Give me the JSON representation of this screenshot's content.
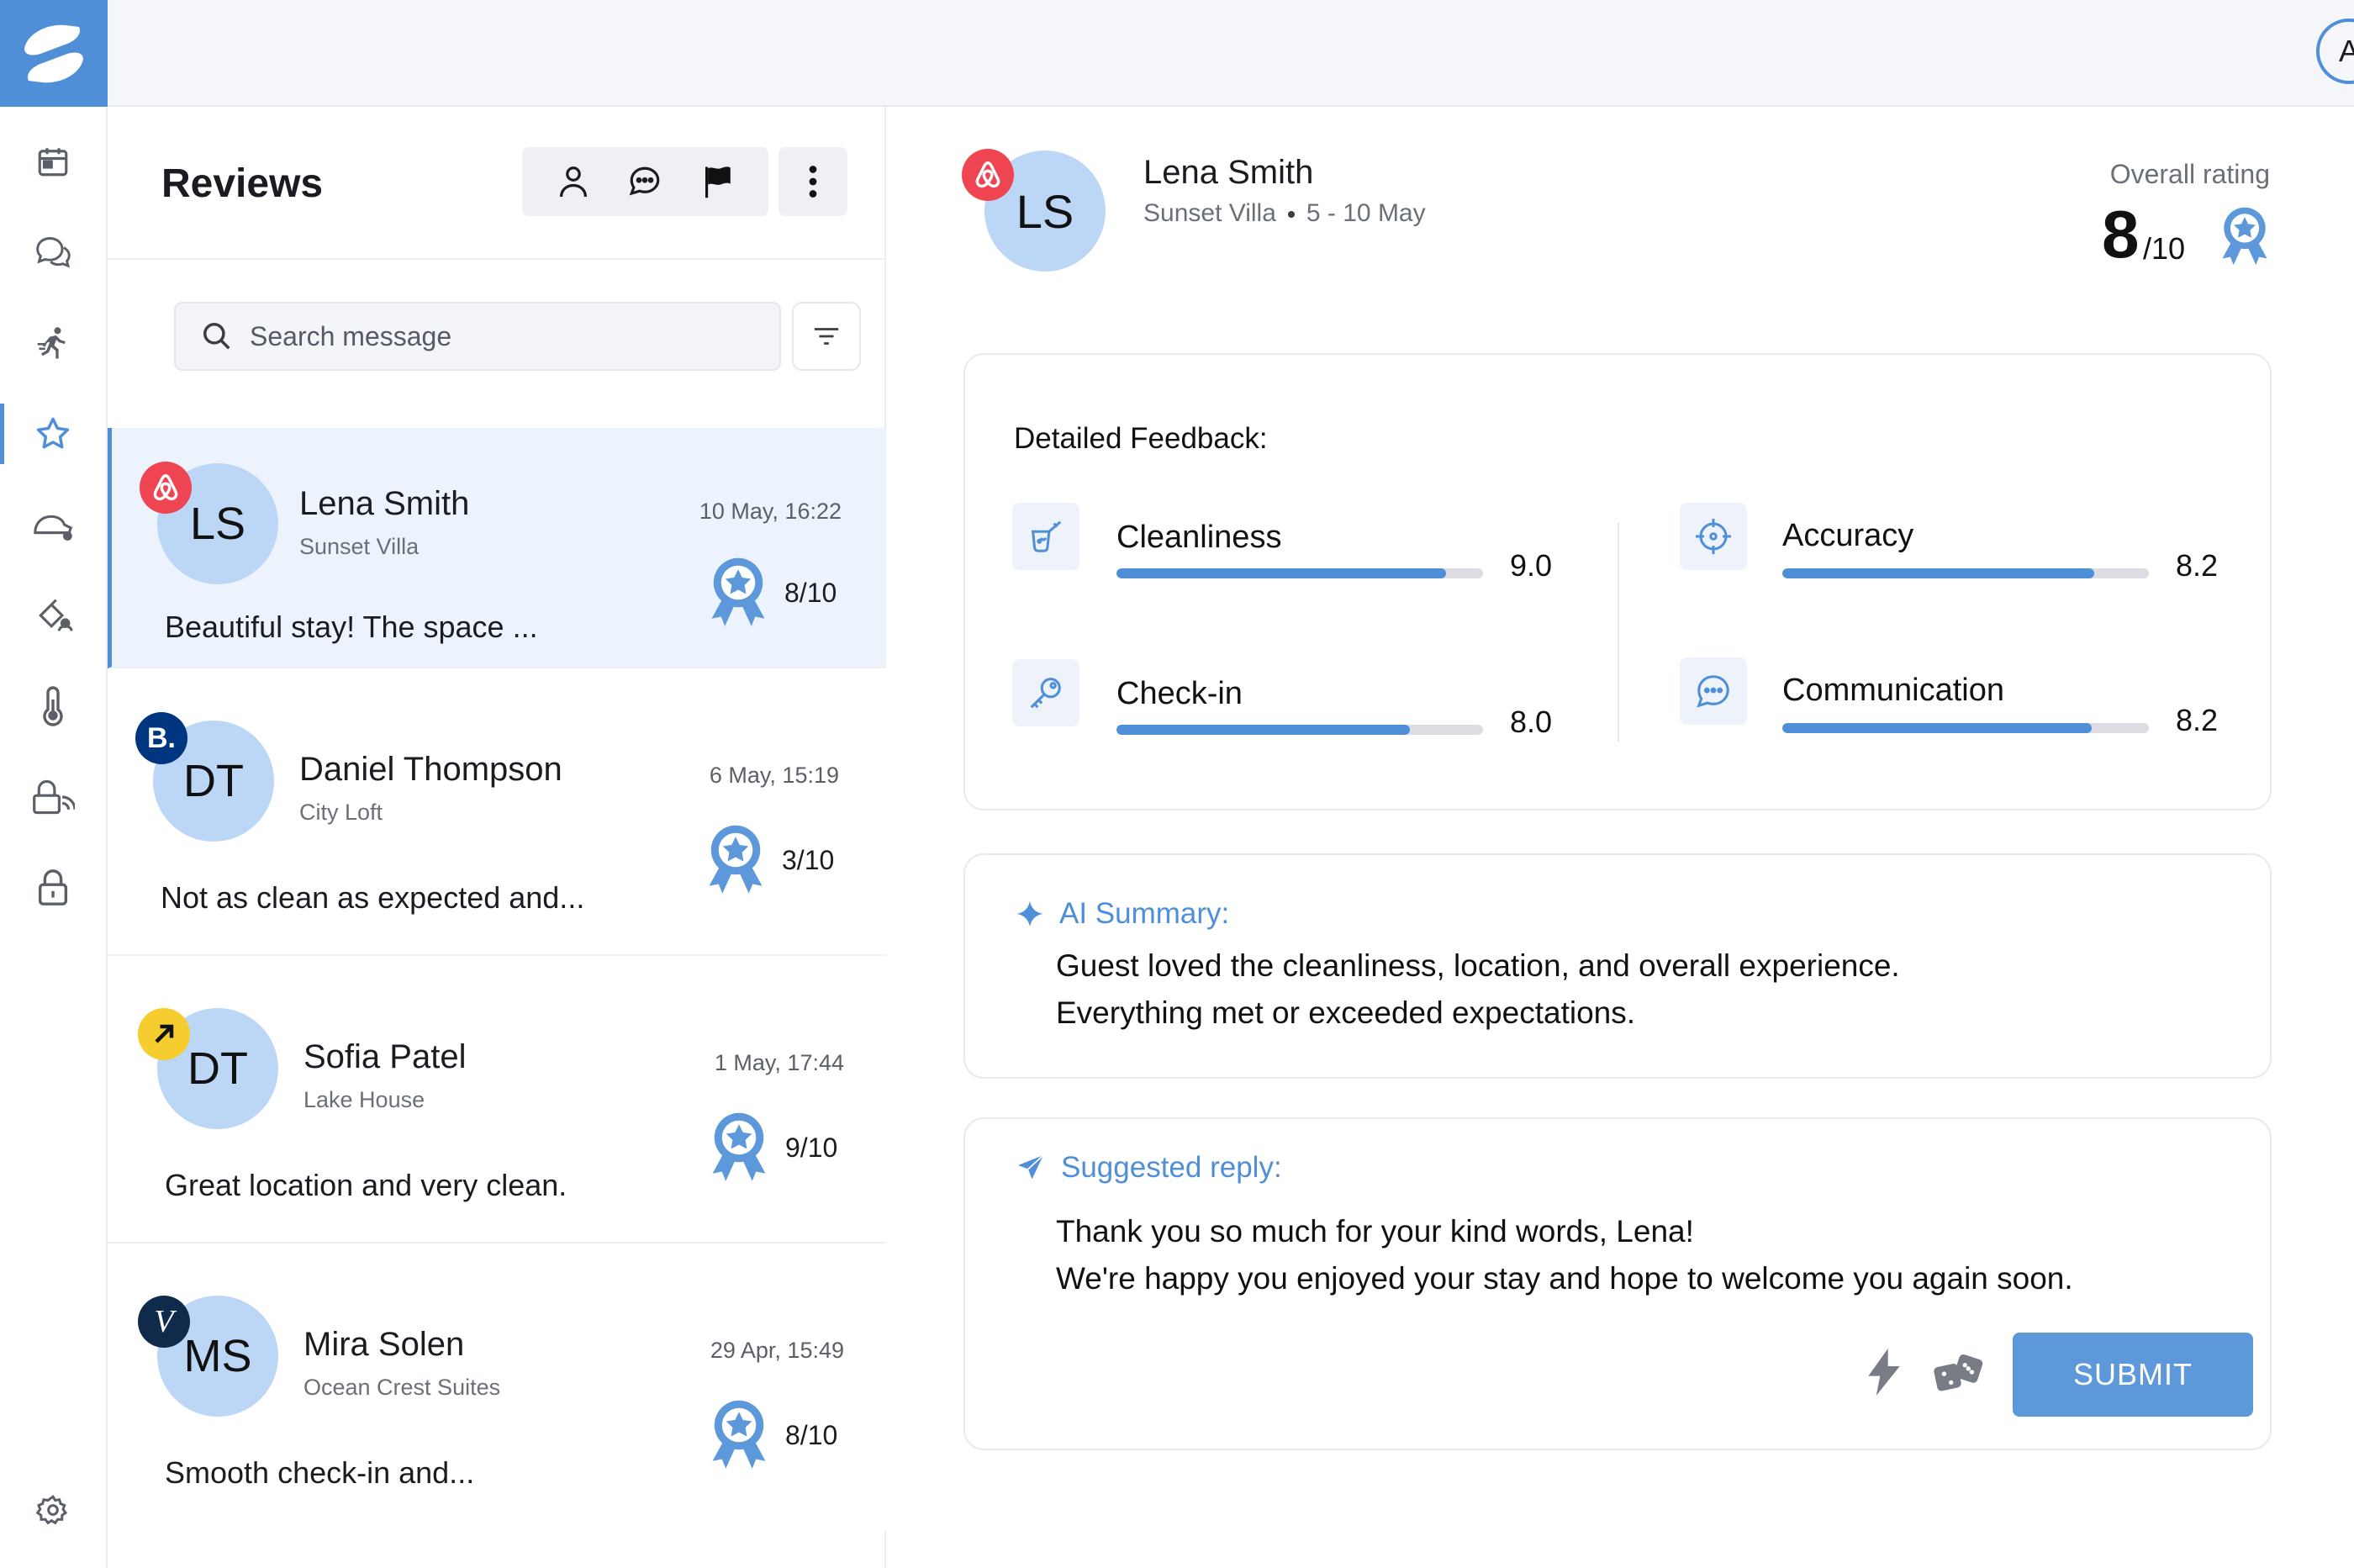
{
  "header": {
    "user_initial": "A"
  },
  "colors": {
    "accent": "#4f8fd8",
    "selected_bg": "#edf3fc",
    "avatar_bg": "#bcd7f5",
    "airbnb": "#ef4452",
    "booking": "#003580",
    "expedia": "#f5cd2e",
    "vrbo": "#102a4c"
  },
  "sidebar": {
    "items": [
      {
        "icon": "calendar-icon"
      },
      {
        "icon": "chat-bubbles-icon"
      },
      {
        "icon": "runner-icon"
      },
      {
        "icon": "star-icon",
        "active": true
      },
      {
        "icon": "cleaning-icon"
      },
      {
        "icon": "tools-icon"
      },
      {
        "icon": "thermometer-icon"
      },
      {
        "icon": "smart-lock-icon"
      },
      {
        "icon": "lock-icon"
      },
      {
        "icon": "settings-icon"
      }
    ]
  },
  "list": {
    "title": "Reviews",
    "search_placeholder": "Search message",
    "items": [
      {
        "initials": "LS",
        "name": "Lena Smith",
        "property": "Sunset Villa",
        "date": "10 May, 16:22",
        "score": "8/10",
        "text": "Beautiful stay! The space ...",
        "channel": "airbnb"
      },
      {
        "initials": "DT",
        "name": "Daniel Thompson",
        "property": "City Loft",
        "date": "6 May, 15:19",
        "score": "3/10",
        "text": "Not as clean as expected and...",
        "channel": "booking",
        "channel_label": "B."
      },
      {
        "initials": "DT",
        "name": "Sofia Patel",
        "property": "Lake House",
        "date": "1 May, 17:44",
        "score": "9/10",
        "text": "Great location and very clean.",
        "channel": "expedia"
      },
      {
        "initials": "MS",
        "name": "Mira Solen",
        "property": "Ocean Crest Suites",
        "date": "29 Apr, 15:49",
        "score": "8/10",
        "text": "Smooth check-in and...",
        "channel": "vrbo",
        "channel_label": "V"
      }
    ]
  },
  "detail": {
    "initials": "LS",
    "name": "Lena Smith",
    "property": "Sunset Villa",
    "dates": "5 - 10 May",
    "overall_label": "Overall rating",
    "overall_score": "8",
    "overall_denominator": "/10",
    "feedback_title": "Detailed Feedback:",
    "feedback": [
      {
        "label": "Cleanliness",
        "value": "9.0",
        "fraction": 0.9,
        "icon": "cleaning-spray-icon"
      },
      {
        "label": "Accuracy",
        "value": "8.2",
        "fraction": 0.85,
        "icon": "crosshair-icon"
      },
      {
        "label": "Check-in",
        "value": "8.0",
        "fraction": 0.8,
        "icon": "key-icon"
      },
      {
        "label": "Communication",
        "value": "8.2",
        "fraction": 0.845,
        "icon": "chat-icon"
      }
    ],
    "ai_summary_title": "AI Summary:",
    "ai_summary_text": "Guest loved the cleanliness, location, and overall experience.\nEverything met or exceeded expectations.",
    "suggested_title": "Suggested reply:",
    "suggested_text": "Thank you so much for your kind words, Lena!\n We're happy you enjoyed your stay and hope to welcome you again soon.",
    "submit_label": "SUBMIT"
  }
}
